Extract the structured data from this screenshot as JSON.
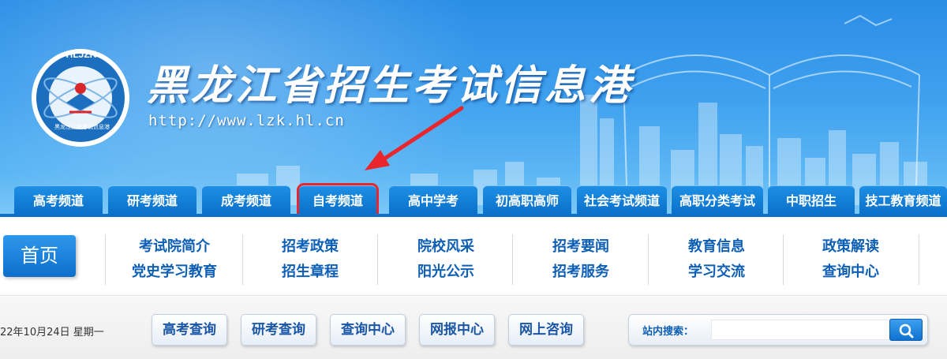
{
  "header": {
    "logo_text": "HLJZK",
    "logo_caption": "黑龙江招生考试信息港",
    "site_title": "黑龙江省招生考试信息港",
    "site_url": "http://www.lzk.hl.cn"
  },
  "channels": [
    {
      "label": "高考频道"
    },
    {
      "label": "研考频道"
    },
    {
      "label": "成考频道"
    },
    {
      "label": "自考频道"
    },
    {
      "label": "高中学考"
    },
    {
      "label": "初高职高师"
    },
    {
      "label": "社会考试频道"
    },
    {
      "label": "高职分类考试"
    },
    {
      "label": "中职招生"
    },
    {
      "label": "技工教育频道"
    }
  ],
  "nav": {
    "home": "首页",
    "columns": [
      [
        "考试院简介",
        "党史学习教育"
      ],
      [
        "招考政策",
        "招生章程"
      ],
      [
        "院校风采",
        "阳光公示"
      ],
      [
        "招考要闻",
        "招考服务"
      ],
      [
        "教育信息",
        "学习交流"
      ],
      [
        "政策解读",
        "查询中心"
      ]
    ]
  },
  "subbar": {
    "date": "22年10月24日 星期一",
    "buttons": [
      "高考查询",
      "研考查询",
      "查询中心",
      "网报中心",
      "网上咨询"
    ],
    "search_label": "站内搜索：",
    "search_value": ""
  },
  "colors": {
    "banner_blue": "#3ea0ee",
    "tab_blue": "#0a6fc9",
    "link_blue": "#0d5fb5",
    "highlight_red": "#e8262b"
  },
  "icons": [
    "search-icon",
    "logo-emblem-icon",
    "arrow-annotation-icon"
  ]
}
